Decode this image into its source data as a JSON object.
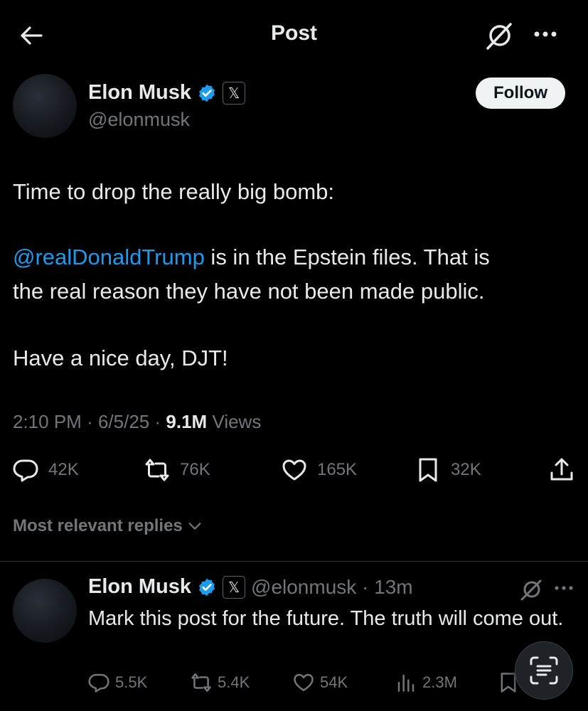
{
  "header": {
    "title": "Post"
  },
  "post": {
    "author_name": "Elon Musk",
    "author_handle": "@elonmusk",
    "x_badge": "𝕏",
    "follow_label": "Follow",
    "line1": "Time to drop the really big bomb:",
    "mention": "@realDonaldTrump",
    "line2a": " is in the Epstein files. That is",
    "line2b": "the real reason they have not been made public.",
    "line3": "Have a nice day, DJT!",
    "time": "2:10 PM",
    "date": "6/5/25",
    "views_count": "9.1M",
    "views_label": "Views",
    "sep": "·"
  },
  "actions": {
    "replies": "42K",
    "reposts": "76K",
    "likes": "165K",
    "bookmarks": "32K"
  },
  "replies_sort": {
    "label": "Most relevant replies"
  },
  "reply": {
    "author_name": "Elon Musk",
    "x_badge": "𝕏",
    "handle_time": "@elonmusk · 13m",
    "text": "Mark this post for the future. The truth will come out.",
    "replies": "5.5K",
    "reposts": "5.4K",
    "likes": "54K",
    "views": "2.3M"
  },
  "colors": {
    "background": "#000000",
    "text": "#e7e9ea",
    "muted": "#71767b",
    "link": "#1d9bf0",
    "verified": "#1d9bf0"
  }
}
